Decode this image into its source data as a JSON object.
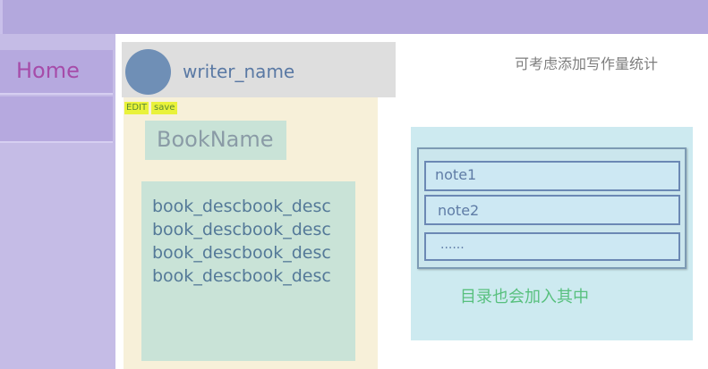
{
  "sidebar": {
    "items": [
      {
        "label": "Home"
      },
      {
        "label": ""
      }
    ]
  },
  "writer": {
    "name": "writer_name"
  },
  "stats_note": "可考虑添加写作量统计",
  "toolbar": {
    "edit_label": "EDIT",
    "save_label": "save"
  },
  "book": {
    "name": "BookName",
    "description_lines": [
      "book_descbook_desc",
      "book_descbook_desc",
      "book_descbook_desc",
      "book_descbook_desc"
    ]
  },
  "toc": {
    "items": [
      {
        "label": "note1"
      },
      {
        "label": "note2"
      },
      {
        "label": "......"
      }
    ],
    "caption": "目录也会加入其中"
  },
  "colors": {
    "topbar": "#b3a8dd",
    "sidebar": "#c5bce6",
    "home_text": "#a64ca9",
    "book_panel": "#f7f0d9",
    "toc_panel": "#cdeaf0"
  }
}
